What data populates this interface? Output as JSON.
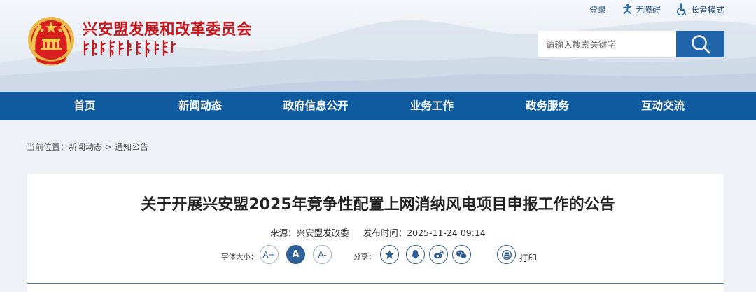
{
  "header": {
    "site_title": "兴安盟发展和改革委员会",
    "top_links": [
      {
        "label": "登录",
        "icon": "login-link"
      },
      {
        "label": "无障碍",
        "icon": "accessibility-icon"
      },
      {
        "label": "长者模式",
        "icon": "elder-mode-icon"
      }
    ],
    "search": {
      "placeholder": "请输入搜索关键字",
      "value": ""
    }
  },
  "nav": {
    "items": [
      "首页",
      "新闻动态",
      "政府信息公开",
      "业务工作",
      "政务服务",
      "互动交流"
    ]
  },
  "breadcrumb": {
    "prefix": "当前位置：",
    "items": [
      "新闻动态",
      "通知公告"
    ],
    "separator": ">"
  },
  "article": {
    "title": "关于开展兴安盟2025年竞争性配置上网消纳风电项目申报工作的公告",
    "source_label": "来源：",
    "source": "兴安盟发改委",
    "published_label": "发布时间：",
    "published": "2025-11-24 09:14"
  },
  "tools": {
    "font_size_label": "字体大小：",
    "font_buttons": [
      "A+",
      "A",
      "A-"
    ],
    "share_label": "分享：",
    "share_icons": [
      "qzone-star-icon",
      "qq-icon",
      "weibo-icon",
      "wechat-icon"
    ],
    "print_label": "打印"
  },
  "colors": {
    "brand_red": "#c8161d",
    "nav_blue": "#105aa0",
    "search_blue": "#2065a9",
    "tool_blue": "#2d5e95"
  }
}
